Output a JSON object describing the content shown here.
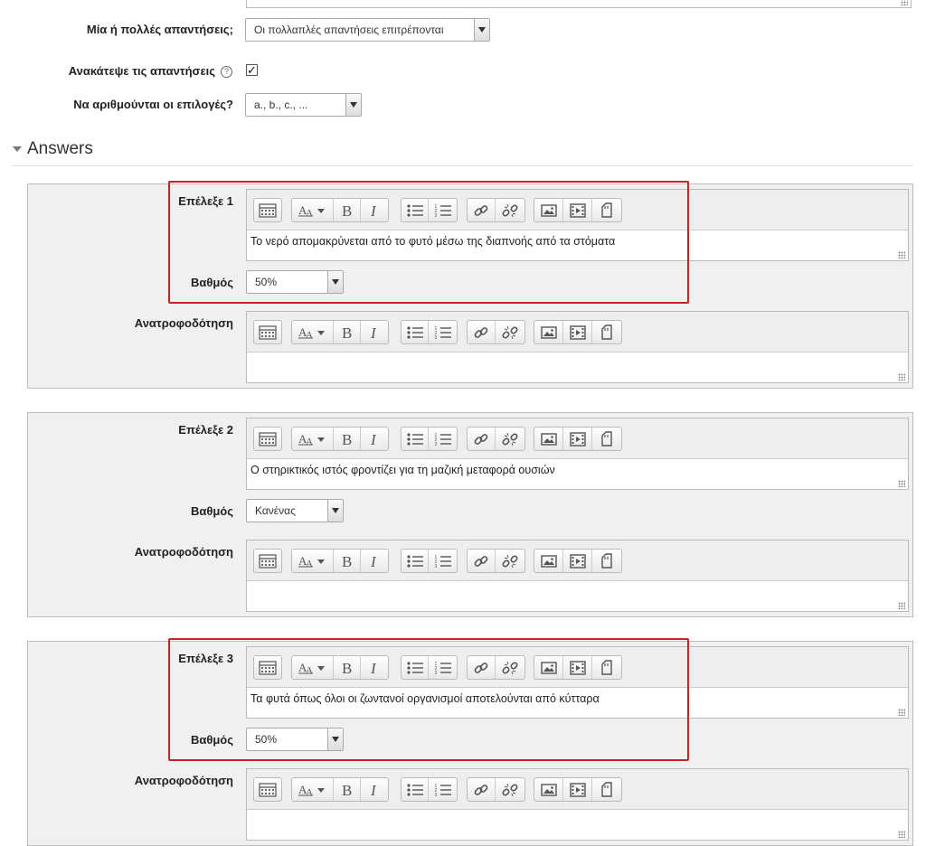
{
  "question_settings": {
    "single_multiple_label": "Μία ή πολλές απαντήσεις;",
    "single_multiple_value": "Οι πολλαπλές απαντήσεις επιτρέπονται",
    "shuffle_label": "Ανακάτεψε τις απαντήσεις",
    "shuffle_checked": true,
    "shuffle_check_glyph": "✓",
    "numbering_label": "Να αριθμούνται οι επιλογές?",
    "numbering_value": "a., b., c., ..."
  },
  "answers_section": {
    "title": "Answers"
  },
  "answers": [
    {
      "choice_label": "Επέλεξε 1",
      "choice_text": "Το νερό απομακρύνεται από το φυτό μέσω της διαπνοής από τα στόματα",
      "grade_label": "Βαθμός",
      "grade_value": "50%",
      "feedback_label": "Ανατροφοδότηση",
      "feedback_text": "",
      "highlighted": true
    },
    {
      "choice_label": "Επέλεξε 2",
      "choice_text": "Ο στηρικτικός ιστός φροντίζει για τη μαζική μεταφορά ουσιών",
      "grade_label": "Βαθμός",
      "grade_value": "Κανένας",
      "feedback_label": "Ανατροφοδότηση",
      "feedback_text": "",
      "highlighted": false
    },
    {
      "choice_label": "Επέλεξε 3",
      "choice_text": "Τα φυτά όπως όλοι οι ζωντανοί οργανισμοί αποτελούνται από κύτταρα",
      "grade_label": "Βαθμός",
      "grade_value": "50%",
      "feedback_label": "Ανατροφοδότηση",
      "feedback_text": "",
      "highlighted": true
    }
  ],
  "toolbar_icons": [
    "toolbar-toggle-icon",
    "font-style-icon",
    "bold-icon",
    "italic-icon",
    "unordered-list-icon",
    "ordered-list-icon",
    "link-icon",
    "unlink-icon",
    "image-icon",
    "media-icon",
    "file-icon"
  ],
  "colors": {
    "highlight_border": "#cc2222",
    "panel_bg": "#f0f0f0",
    "toolbar_bg": "#eeeeee"
  }
}
